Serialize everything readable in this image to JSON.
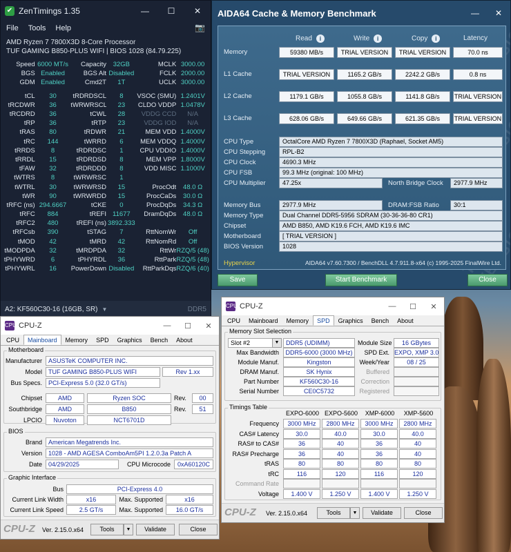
{
  "zentimings": {
    "title": "ZenTimings 1.35",
    "window_buttons": [
      "—",
      "☐",
      "✕"
    ],
    "menu": [
      "File",
      "Tools",
      "Help"
    ],
    "cpu": "AMD Ryzen 7 7800X3D 8-Core Processor",
    "board": "TUF GAMING B850-PLUS WIFI | BIOS 1028 (84.79.225)",
    "top_rows": [
      [
        "Speed",
        "6000 MT/s",
        "Capacity",
        "32GB",
        "MCLK",
        "3000.00"
      ],
      [
        "BGS",
        "Enabled",
        "BGS Alt",
        "Disabled",
        "FCLK",
        "2000.00"
      ],
      [
        "GDM",
        "Enabled",
        "Cmd2T",
        "1T",
        "UCLK",
        "3000.00"
      ]
    ],
    "timing_rows": [
      [
        "tCL",
        "30",
        "tRDRDSCL",
        "8",
        "VSOC (SMU)",
        "1.2401V"
      ],
      [
        "tRCDWR",
        "36",
        "tWRWRSCL",
        "23",
        "CLDO VDDP",
        "1.0478V"
      ],
      [
        "tRCDRD",
        "36",
        "tCWL",
        "28",
        "VDDG CCD",
        "N/A"
      ],
      [
        "tRP",
        "36",
        "tRTP",
        "23",
        "VDDG IOD",
        "N/A"
      ],
      [
        "tRAS",
        "80",
        "tRDWR",
        "21",
        "MEM VDD",
        "1.4000V"
      ],
      [
        "tRC",
        "144",
        "tWRRD",
        "6",
        "MEM VDDQ",
        "1.4000V"
      ],
      [
        "tRRDS",
        "8",
        "tRDRDSC",
        "1",
        "CPU VDDIO",
        "1.4000V"
      ],
      [
        "tRRDL",
        "15",
        "tRDRDSD",
        "8",
        "MEM VPP",
        "1.8000V"
      ],
      [
        "tFAW",
        "32",
        "tRDRDDD",
        "8",
        "VDD MISC",
        "1.1000V"
      ],
      [
        "tWTRS",
        "8",
        "tWRWRSC",
        "1",
        "",
        ""
      ],
      [
        "tWTRL",
        "30",
        "tWRWRSD",
        "15",
        "ProcOdt",
        "48.0 Ω"
      ],
      [
        "tWR",
        "90",
        "tWRWRDD",
        "15",
        "ProcCaDs",
        "30.0 Ω"
      ],
      [
        "tRFC (ns)",
        "294.6667",
        "tCKE",
        "0",
        "ProcDqDs",
        "34.3 Ω"
      ],
      [
        "tRFC",
        "884",
        "tREFI",
        "11677",
        "DramDqDs",
        "48.0 Ω"
      ],
      [
        "tRFC2",
        "480",
        "tREFI (ns)",
        "3892.333",
        "",
        ""
      ],
      [
        "tRFCsb",
        "390",
        "tSTAG",
        "7",
        "RttNomWr",
        "Off"
      ],
      [
        "tMOD",
        "42",
        "tMRD",
        "42",
        "RttNomRd",
        "Off"
      ],
      [
        "tMODPDA",
        "32",
        "tMRDPDA",
        "32",
        "RttWr",
        "RZQ/5 (48)"
      ],
      [
        "tPHYWRD",
        "6",
        "tPHYRDL",
        "36",
        "RttPark",
        "RZQ/5 (48)"
      ],
      [
        "tPHYWRL",
        "16",
        "PowerDown",
        "Disabled",
        "RttParkDqs",
        "RZQ/6 (40)"
      ]
    ],
    "module": "A2: KF560C30-16 (16GB, SR)",
    "ddr": "DDR5"
  },
  "aida": {
    "title": "AIDA64 Cache & Memory Benchmark",
    "window_buttons": [
      "—",
      "✕"
    ],
    "col_heads": [
      "Read",
      "Write",
      "Copy",
      "Latency"
    ],
    "info_icon": "i",
    "rows": [
      {
        "label": "Memory",
        "read": "59380 MB/s",
        "write": "TRIAL VERSION",
        "copy": "TRIAL VERSION",
        "lat": "70.0 ns"
      },
      {
        "label": "L1 Cache",
        "read": "TRIAL VERSION",
        "write": "1165.2 GB/s",
        "copy": "2242.2 GB/s",
        "lat": "0.8 ns"
      },
      {
        "label": "L2 Cache",
        "read": "1179.1 GB/s",
        "write": "1055.8 GB/s",
        "copy": "1141.8 GB/s",
        "lat": "TRIAL VERSION"
      },
      {
        "label": "L3 Cache",
        "read": "628.06 GB/s",
        "write": "649.66 GB/s",
        "copy": "621.35 GB/s",
        "lat": "TRIAL VERSION"
      }
    ],
    "cpu_type_label": "CPU Type",
    "cpu_type": "OctalCore AMD Ryzen 7 7800X3D  (Raphael, Socket AM5)",
    "cpu_stepping_label": "CPU Stepping",
    "cpu_stepping": "RPL-B2",
    "cpu_clock_label": "CPU Clock",
    "cpu_clock": "4690.3 MHz",
    "cpu_fsb_label": "CPU FSB",
    "cpu_fsb": "99.3 MHz  (original: 100 MHz)",
    "cpu_mult_label": "CPU Multiplier",
    "cpu_mult": "47.25x",
    "nb_clock_label": "North Bridge Clock",
    "nb_clock": "2977.9 MHz",
    "mem_bus_label": "Memory Bus",
    "mem_bus": "2977.9 MHz",
    "dram_fsb_label": "DRAM:FSB Ratio",
    "dram_fsb": "30:1",
    "mem_type_label": "Memory Type",
    "mem_type": "Dual Channel DDR5-5956 SDRAM  (30-36-36-80 CR1)",
    "chipset_label": "Chipset",
    "chipset": "AMD B850, AMD K19.6 FCH, AMD K19.6 IMC",
    "motherboard_label": "Motherboard",
    "motherboard": "[ TRIAL VERSION ]",
    "bios_label": "BIOS Version",
    "bios": "1028",
    "hypervisor": "Hypervisor",
    "version": "AIDA64 v7.60.7300 / BenchDLL 4.7.911.8-x64  (c) 1995-2025 FinalWire Ltd.",
    "save": "Save",
    "start": "Start Benchmark",
    "close": "Close",
    "watermark": "TRIAL VERSION"
  },
  "cpuz_mb": {
    "title": "CPU-Z",
    "logo": "CPU",
    "window_buttons": [
      "—",
      "☐",
      "✕"
    ],
    "tabs": [
      "CPU",
      "Mainboard",
      "Memory",
      "SPD",
      "Graphics",
      "Bench",
      "About"
    ],
    "active_tab": 1,
    "mb_group": "Motherboard",
    "manufacturer_label": "Manufacturer",
    "manufacturer": "ASUSTeK COMPUTER INC.",
    "model_label": "Model",
    "model": "TUF GAMING B850-PLUS WIFI",
    "model_rev": "Rev 1.xx",
    "bus_label": "Bus Specs.",
    "bus": "PCI-Express 5.0 (32.0 GT/s)",
    "chipset_label": "Chipset",
    "chipset_vendor": "AMD",
    "chipset_name": "Ryzen SOC",
    "rev_label": "Rev.",
    "chipset_rev": "00",
    "south_label": "Southbridge",
    "south_vendor": "AMD",
    "south_name": "B850",
    "south_rev": "51",
    "lpcio_label": "LPCIO",
    "lpcio_vendor": "Nuvoton",
    "lpcio_name": "NCT6701D",
    "bios_group": "BIOS",
    "brand_label": "Brand",
    "brand": "American Megatrends Inc.",
    "version_label": "Version",
    "version": "1028 - AMD AGESA ComboAm5PI 1.2.0.3a Patch A",
    "date_label": "Date",
    "date": "04/29/2025",
    "microcode_label": "CPU Microcode",
    "microcode": "0xA60120C",
    "gfx_group": "Graphic Interface",
    "gbus_label": "Bus",
    "gbus": "PCI-Express 4.0",
    "link_width_label": "Current Link Width",
    "link_width": "x16",
    "max_sup_label": "Max. Supported",
    "max_width": "x16",
    "link_speed_label": "Current Link Speed",
    "link_speed": "2.5 GT/s",
    "max_speed": "16.0 GT/s",
    "brand_text": "CPU-Z",
    "ver": "Ver. 2.15.0.x64",
    "tools": "Tools",
    "validate": "Validate",
    "close": "Close"
  },
  "cpuz_spd": {
    "title": "CPU-Z",
    "logo": "CPU",
    "window_buttons": [
      "—",
      "☐",
      "✕"
    ],
    "tabs": [
      "CPU",
      "Mainboard",
      "Memory",
      "SPD",
      "Graphics",
      "Bench",
      "About"
    ],
    "active_tab": 3,
    "slot_group": "Memory Slot Selection",
    "slot": "Slot #2",
    "slot_type": "DDR5 (UDIMM)",
    "module_size_label": "Module Size",
    "module_size": "16 GBytes",
    "max_bw_label": "Max Bandwidth",
    "max_bw": "DDR5-6000 (3000 MHz)",
    "spd_ext_label": "SPD Ext.",
    "spd_ext": "EXPO, XMP 3.0",
    "manuf_label": "Module Manuf.",
    "manuf": "Kingston",
    "week_label": "Week/Year",
    "week": "08 / 25",
    "dram_label": "DRAM Manuf.",
    "dram": "SK Hynix",
    "buffered_label": "Buffered",
    "part_label": "Part Number",
    "part": "KF560C30-16",
    "correction_label": "Correction",
    "serial_label": "Serial Number",
    "serial": "CE0C5732",
    "registered_label": "Registered",
    "timings_group": "Timings Table",
    "timing_cols": [
      "EXPO-6000",
      "EXPO-5600",
      "XMP-6000",
      "XMP-5600"
    ],
    "timing_rows": [
      {
        "label": "Frequency",
        "vals": [
          "3000 MHz",
          "2800 MHz",
          "3000 MHz",
          "2800 MHz"
        ]
      },
      {
        "label": "CAS# Latency",
        "vals": [
          "30.0",
          "40.0",
          "30.0",
          "40.0"
        ]
      },
      {
        "label": "RAS# to CAS#",
        "vals": [
          "36",
          "40",
          "36",
          "40"
        ]
      },
      {
        "label": "RAS# Precharge",
        "vals": [
          "36",
          "40",
          "36",
          "40"
        ]
      },
      {
        "label": "tRAS",
        "vals": [
          "80",
          "80",
          "80",
          "80"
        ]
      },
      {
        "label": "tRC",
        "vals": [
          "116",
          "120",
          "116",
          "120"
        ]
      },
      {
        "label": "Command Rate",
        "vals": [
          "",
          "",
          "",
          ""
        ]
      },
      {
        "label": "Voltage",
        "vals": [
          "1.400 V",
          "1.250 V",
          "1.400 V",
          "1.250 V"
        ]
      }
    ],
    "brand_text": "CPU-Z",
    "ver": "Ver. 2.15.0.x64",
    "tools": "Tools",
    "validate": "Validate",
    "close": "Close"
  }
}
